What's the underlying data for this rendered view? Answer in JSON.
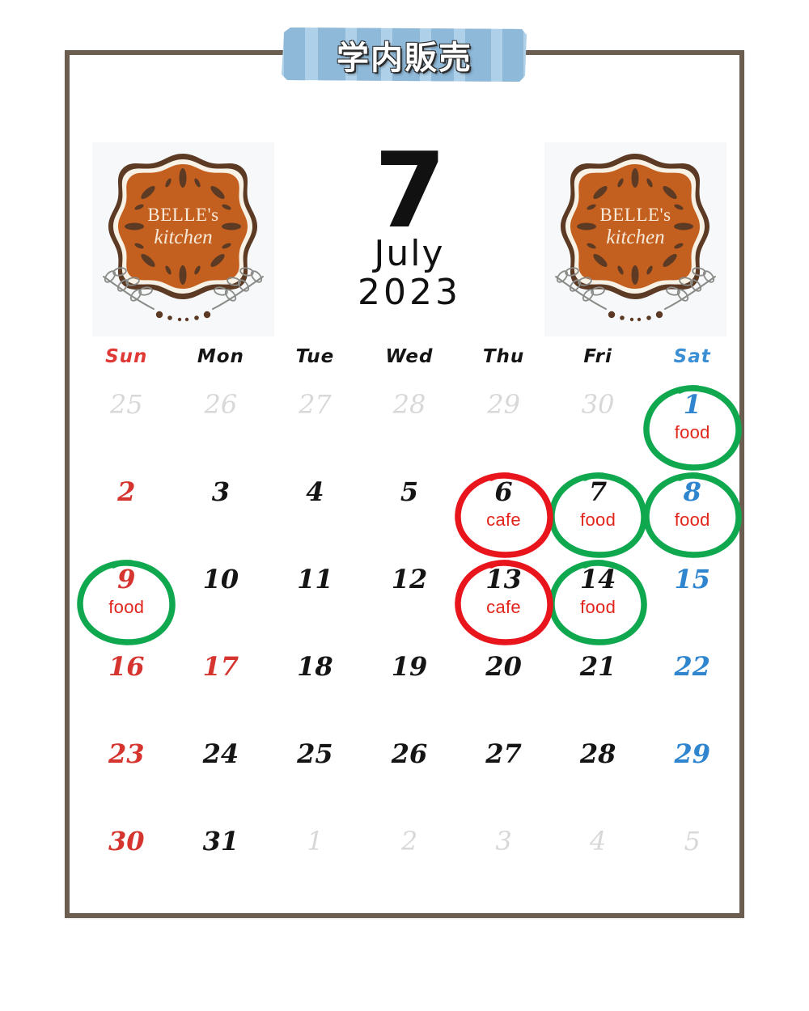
{
  "banner": {
    "label": "学内販売",
    "tape_color_dark": "#8fb9d9",
    "tape_color_light": "#aed0e8"
  },
  "frame": {
    "border_color": "#6b5e50",
    "background": "#ffffff"
  },
  "logo": {
    "line1": "BELLE's",
    "line2": "kitchen",
    "badge_color": "#c4601f",
    "ring_color": "#5c3a23",
    "text_color": "#f7e9d8",
    "panel_background": "#f6f8fa"
  },
  "month": {
    "number": "7",
    "name": "July",
    "year": "2023"
  },
  "weekdays": [
    {
      "label": "Sun",
      "kind": "sun"
    },
    {
      "label": "Mon",
      "kind": "wd"
    },
    {
      "label": "Tue",
      "kind": "wd"
    },
    {
      "label": "Wed",
      "kind": "wd"
    },
    {
      "label": "Thu",
      "kind": "wd"
    },
    {
      "label": "Fri",
      "kind": "wd"
    },
    {
      "label": "Sat",
      "kind": "sat"
    }
  ],
  "legend": {
    "food_color": "#0fa84f",
    "cafe_color": "#e8151c",
    "tag_text_color": "#e1251b",
    "sunday_color": "#d5342f",
    "saturday_color": "#2f86cf",
    "outside_color": "#d8d8d8"
  },
  "days": [
    {
      "n": "25",
      "type": "out"
    },
    {
      "n": "26",
      "type": "out"
    },
    {
      "n": "27",
      "type": "out"
    },
    {
      "n": "28",
      "type": "out"
    },
    {
      "n": "29",
      "type": "out"
    },
    {
      "n": "30",
      "type": "out"
    },
    {
      "n": "1",
      "type": "sat",
      "tag": "food",
      "mark": "food"
    },
    {
      "n": "2",
      "type": "sun"
    },
    {
      "n": "3",
      "type": "day"
    },
    {
      "n": "4",
      "type": "day"
    },
    {
      "n": "5",
      "type": "day"
    },
    {
      "n": "6",
      "type": "day",
      "tag": "cafe",
      "mark": "cafe"
    },
    {
      "n": "7",
      "type": "day",
      "tag": "food",
      "mark": "food"
    },
    {
      "n": "8",
      "type": "sat",
      "tag": "food",
      "mark": "food"
    },
    {
      "n": "9",
      "type": "sun",
      "tag": "food",
      "mark": "food"
    },
    {
      "n": "10",
      "type": "day"
    },
    {
      "n": "11",
      "type": "day"
    },
    {
      "n": "12",
      "type": "day"
    },
    {
      "n": "13",
      "type": "day",
      "tag": "cafe",
      "mark": "cafe"
    },
    {
      "n": "14",
      "type": "day",
      "tag": "food",
      "mark": "food"
    },
    {
      "n": "15",
      "type": "sat"
    },
    {
      "n": "16",
      "type": "sun"
    },
    {
      "n": "17",
      "type": "hol"
    },
    {
      "n": "18",
      "type": "day"
    },
    {
      "n": "19",
      "type": "day"
    },
    {
      "n": "20",
      "type": "day"
    },
    {
      "n": "21",
      "type": "day"
    },
    {
      "n": "22",
      "type": "sat"
    },
    {
      "n": "23",
      "type": "sun"
    },
    {
      "n": "24",
      "type": "day"
    },
    {
      "n": "25",
      "type": "day"
    },
    {
      "n": "26",
      "type": "day"
    },
    {
      "n": "27",
      "type": "day"
    },
    {
      "n": "28",
      "type": "day"
    },
    {
      "n": "29",
      "type": "sat"
    },
    {
      "n": "30",
      "type": "sun"
    },
    {
      "n": "31",
      "type": "day"
    },
    {
      "n": "1",
      "type": "out"
    },
    {
      "n": "2",
      "type": "out"
    },
    {
      "n": "3",
      "type": "out"
    },
    {
      "n": "4",
      "type": "out"
    },
    {
      "n": "5",
      "type": "out"
    }
  ]
}
